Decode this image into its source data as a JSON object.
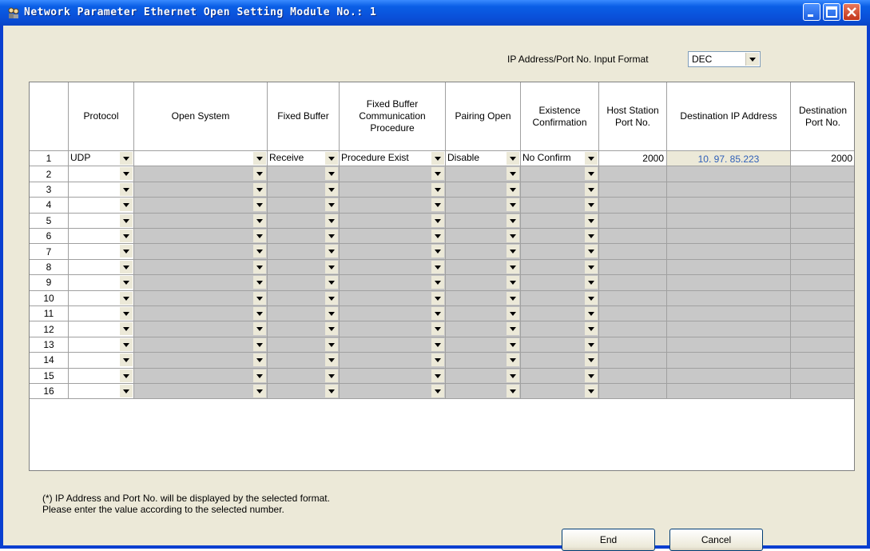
{
  "window": {
    "title": "Network Parameter  Ethernet Open Setting Module No.: 1"
  },
  "format": {
    "label": "IP Address/Port No. Input Format",
    "value": "DEC"
  },
  "table": {
    "columns": [
      "Protocol",
      "Open System",
      "Fixed Buffer",
      "Fixed Buffer Communication Procedure",
      "Pairing Open",
      "Existence Confirmation",
      "Host Station Port No.",
      "Destination IP Address",
      "Destination Port No."
    ],
    "rows": [
      {
        "no": "1",
        "protocol": "UDP",
        "open_system": "",
        "fixed_buffer": "Receive",
        "procedure": "Procedure Exist",
        "pairing": "Disable",
        "existence": "No Confirm",
        "host_port": "2000",
        "dest_ip": "10. 97. 85.223",
        "dest_port": "2000"
      },
      {
        "no": "2"
      },
      {
        "no": "3"
      },
      {
        "no": "4"
      },
      {
        "no": "5"
      },
      {
        "no": "6"
      },
      {
        "no": "7"
      },
      {
        "no": "8"
      },
      {
        "no": "9"
      },
      {
        "no": "10"
      },
      {
        "no": "11"
      },
      {
        "no": "12"
      },
      {
        "no": "13"
      },
      {
        "no": "14"
      },
      {
        "no": "15"
      },
      {
        "no": "16"
      }
    ]
  },
  "note": {
    "line1": "(*) IP Address and Port No. will be displayed by the selected format.",
    "line2": "Please enter the value according to the selected number."
  },
  "buttons": {
    "end": "End",
    "cancel": "Cancel"
  },
  "colors": {
    "titlebar": "#0a4fd8",
    "dialog_bg": "#ece9d8",
    "disabled_cell": "#c8c8c8",
    "ip_text": "#3060b8"
  },
  "icons": {
    "app": "network-people-icon",
    "minimize": "minimize-icon",
    "maximize": "maximize-icon",
    "close": "close-icon",
    "dropdown": "chevron-down-icon"
  }
}
